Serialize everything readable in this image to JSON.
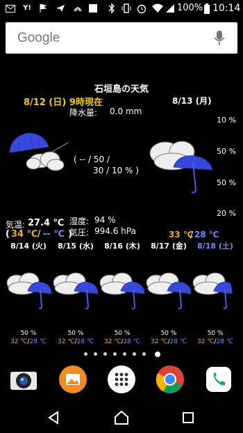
{
  "status_bar": {
    "battery_percent": "100%",
    "time": "10:14",
    "icons": [
      "mail-icon",
      "ymobile-icon",
      "flag-icon",
      "send-icon",
      "nfc-icon",
      "square-icon",
      "bluetooth-icon",
      "vibrate-icon",
      "alarm-icon",
      "wifi-icon",
      "signal-icon",
      "battery-icon"
    ]
  },
  "search": {
    "logo": "Google",
    "mic_icon": "mic-icon"
  },
  "weather": {
    "title": "石垣島の天気",
    "today_label": "8/12 (日) 9時現在",
    "tomorrow_label": "8/13 (月)",
    "precip_label": "降水量:",
    "precip_value": "0.0 mm",
    "today_pop_line1": "( -- / 50 /",
    "today_pop_line2": "30 / 10 % )",
    "temp_label": "気温:",
    "temp_value": "27.4 ℃",
    "temp_range_open": "(",
    "temp_high": "34 ℃",
    "temp_sep": "/",
    "temp_low": "-- ℃",
    "temp_range_close": ")",
    "humidity_label": "湿度:",
    "humidity_value": "94 %",
    "pressure_label": "気圧:",
    "pressure_value": "994.6 hPa",
    "tomorrow_pops": [
      "10 %",
      "50 %",
      "50 %",
      "20 %"
    ],
    "tomorrow_high": "33 ℃",
    "tomorrow_sep": "/",
    "tomorrow_low": "28 ℃",
    "forecast": [
      {
        "date": "8/14 (火)",
        "pop": "50 %",
        "high": "32 ℃",
        "sep": "/",
        "low": "28 ℃",
        "color": "#ffffff"
      },
      {
        "date": "8/15 (水)",
        "pop": "50 %",
        "high": "32 ℃",
        "sep": "/",
        "low": "28 ℃",
        "color": "#ffffff"
      },
      {
        "date": "8/16 (木)",
        "pop": "50 %",
        "high": "32 ℃",
        "sep": "/",
        "low": "28 ℃",
        "color": "#ffffff"
      },
      {
        "date": "8/17 (金)",
        "pop": "50 %",
        "high": "32 ℃",
        "sep": "/",
        "low": "28 ℃",
        "color": "#ffffff"
      },
      {
        "date": "8/18 (土)",
        "pop": "50 %",
        "high": "32 ℃",
        "sep": "/",
        "low": "28 ℃",
        "color": "#6b8cff"
      }
    ]
  },
  "page_indicator": {
    "count": 8,
    "active_index": 7
  },
  "dock": [
    {
      "name": "camera-app-icon",
      "color": "#e8e8e8"
    },
    {
      "name": "album-app-icon",
      "color": "#f28b22"
    },
    {
      "name": "app-drawer-icon",
      "color": "#ffffff"
    },
    {
      "name": "chrome-app-icon",
      "color": "#4285f4"
    },
    {
      "name": "phone-app-icon",
      "color": "#ffffff"
    }
  ],
  "nav": [
    "back-icon",
    "home-icon",
    "recents-icon"
  ],
  "colors": {
    "today": "#f5c518",
    "high": "#f5a623",
    "low": "#6b8cff"
  }
}
